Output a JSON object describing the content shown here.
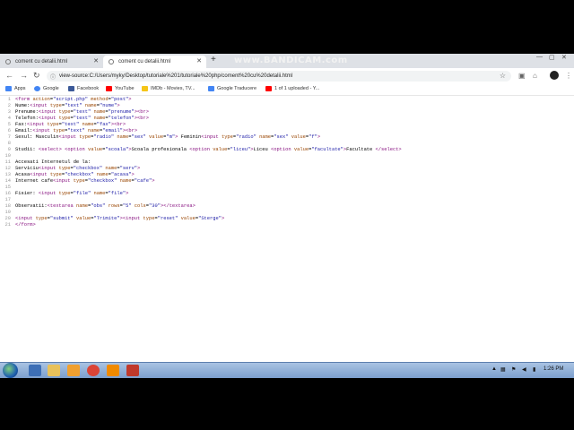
{
  "browser": {
    "tabs": [
      {
        "title": "coment cu detalii.html",
        "active": false
      },
      {
        "title": "coment cu detalii.html",
        "active": true
      }
    ],
    "new_tab_label": "+",
    "watermark": "www.BANDICAM.com",
    "address": "view-source:C:/Users/myky/Desktop/tutoriale%201/tutoriale%20php/coment%20cu%20detalii.html",
    "bookmarks": [
      {
        "label": "Apps",
        "icon": "apps-grid-icon",
        "color": "#4285f4"
      },
      {
        "label": "Google",
        "icon": "google-icon",
        "color": "#4285f4"
      },
      {
        "label": "Facebook",
        "icon": "facebook-icon",
        "color": "#3b5998"
      },
      {
        "label": "YouTube",
        "icon": "youtube-icon",
        "color": "#ff0000"
      },
      {
        "label": "IMDb - Movies, TV...",
        "icon": "imdb-icon",
        "color": "#f5c518"
      },
      {
        "label": "Google Traducere",
        "icon": "google-translate-icon",
        "color": "#4285f4"
      },
      {
        "label": "1 of 1 uploaded - Y...",
        "icon": "youtube-icon",
        "color": "#ff0000"
      }
    ]
  },
  "source_lines": [
    {
      "n": "1",
      "text": "<form action=\"script.php\" method=\"post\">"
    },
    {
      "n": "2",
      "text": "Nume:<input type=\"text\" name=\"nume\">"
    },
    {
      "n": "3",
      "text": "Prenume:<input type=\"text\" name=\"prenume\"><br>"
    },
    {
      "n": "4",
      "text": "Telefon:<input type=\"text\" name=\"telefon\"><br>"
    },
    {
      "n": "5",
      "text": "Fax:<input type=\"text\" name=\"fax\"><br>"
    },
    {
      "n": "6",
      "text": "Email:<input type=\"text\" name=\"email\"><br>"
    },
    {
      "n": "7",
      "text": "Sexul: Masculin<input type=\"radio\" name=\"sex\" value=\"m\"> Feminin<input type=\"radio\" name=\"sex\" value=\"f\">"
    },
    {
      "n": "8",
      "text": ""
    },
    {
      "n": "9",
      "text": "Studii: <select> <option value=\"scoala\">Scoala profesionala <option value=\"liceu\">Liceu <option value=\"facultate\">Facultate </select>"
    },
    {
      "n": "10",
      "text": ""
    },
    {
      "n": "11",
      "text": "Accesati Internetul de la:"
    },
    {
      "n": "12",
      "text": "Serviciu<input type=\"checkbox\" name=\"serv\">"
    },
    {
      "n": "13",
      "text": "Acasa<input type=\"checkbox\" name=\"acasa\">"
    },
    {
      "n": "14",
      "text": "Internet cafe<input type=\"checkbox\" name=\"cafe\">"
    },
    {
      "n": "15",
      "text": ""
    },
    {
      "n": "16",
      "text": "Fisier: <input type=\"file\" name=\"file\">"
    },
    {
      "n": "17",
      "text": ""
    },
    {
      "n": "18",
      "text": "Observatii:<textarea name=\"obs\" rows=\"5\" cols=\"30\"></textarea>"
    },
    {
      "n": "19",
      "text": ""
    },
    {
      "n": "20",
      "text": "<input type=\"submit\" value=\"Trimite\"><input type=\"reset\" value=\"Sterge\">"
    },
    {
      "n": "21",
      "text": "</form>"
    }
  ],
  "taskbar": {
    "clock": "1:26 PM",
    "apps": [
      {
        "name": "windows-explorer-icon",
        "color": "#3d6fb6"
      },
      {
        "name": "file-explorer-icon",
        "color": "#e8c15a"
      },
      {
        "name": "media-player-icon",
        "color": "#f0a030"
      },
      {
        "name": "chrome-icon",
        "color": "#db4437"
      },
      {
        "name": "vlc-icon",
        "color": "#f08a00"
      },
      {
        "name": "bandicam-icon",
        "color": "#c0392b"
      }
    ]
  }
}
